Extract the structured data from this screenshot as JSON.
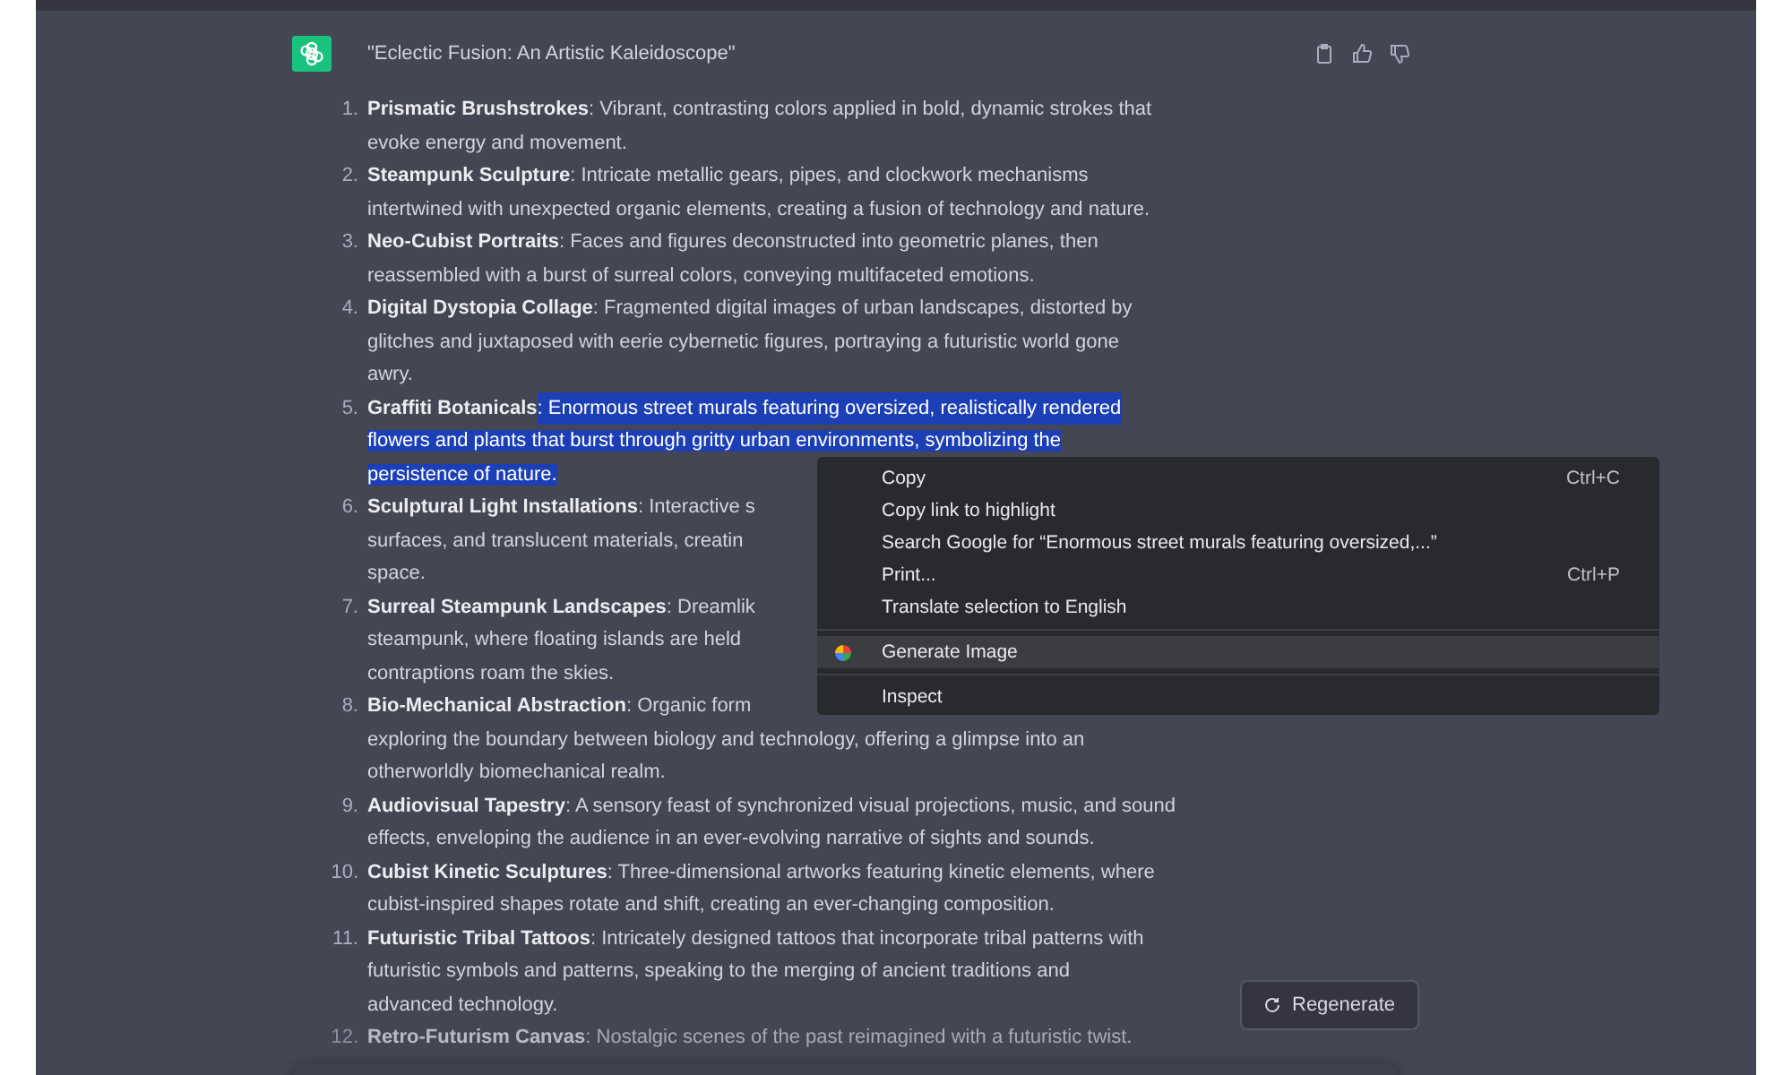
{
  "message": {
    "title": "\"Eclectic Fusion: An Artistic Kaleidoscope\""
  },
  "items": [
    {
      "number": "1.",
      "title": "Prismatic Brushstrokes",
      "highlighted": false,
      "faded": false,
      "lines": [
        ": Vibrant, contrasting colors applied in bold, dynamic strokes that",
        "evoke energy and movement."
      ]
    },
    {
      "number": "2.",
      "title": "Steampunk Sculpture",
      "highlighted": false,
      "faded": false,
      "lines": [
        ": Intricate metallic gears, pipes, and clockwork mechanisms",
        "intertwined with unexpected organic elements, creating a fusion of technology and nature."
      ]
    },
    {
      "number": "3.",
      "title": "Neo-Cubist Portraits",
      "highlighted": false,
      "faded": false,
      "lines": [
        ": Faces and figures deconstructed into geometric planes, then",
        "reassembled with a burst of surreal colors, conveying multifaceted emotions."
      ]
    },
    {
      "number": "4.",
      "title": "Digital Dystopia Collage",
      "highlighted": false,
      "faded": false,
      "lines": [
        ": Fragmented digital images of urban landscapes, distorted by",
        "glitches and juxtaposed with eerie cybernetic figures, portraying a futuristic world gone",
        "awry."
      ]
    },
    {
      "number": "5.",
      "title": "Graffiti Botanicals",
      "highlighted": true,
      "faded": false,
      "lines": [
        ": Enormous street murals featuring oversized, realistically rendered",
        "flowers and plants that burst through gritty urban environments, symbolizing the",
        "persistence of nature."
      ]
    },
    {
      "number": "6.",
      "title": "Sculptural Light Installations",
      "highlighted": false,
      "faded": false,
      "lines": [
        ": Interactive s",
        "surfaces, and translucent materials, creatin",
        "space."
      ]
    },
    {
      "number": "7.",
      "title": "Surreal Steampunk Landscapes",
      "highlighted": false,
      "faded": false,
      "lines": [
        ": Dreamlik",
        "steampunk, where floating islands are held",
        "contraptions roam the skies."
      ]
    },
    {
      "number": "8.",
      "title": "Bio-Mechanical Abstraction",
      "highlighted": false,
      "faded": false,
      "lines": [
        ": Organic form",
        "exploring the boundary between biology and technology, offering a glimpse into an",
        "otherworldly biomechanical realm."
      ]
    },
    {
      "number": "9.",
      "title": "Audiovisual Tapestry",
      "highlighted": false,
      "faded": false,
      "lines": [
        ": A sensory feast of synchronized visual projections, music, and sound",
        "effects, enveloping the audience in an ever-evolving narrative of sights and sounds."
      ]
    },
    {
      "number": "10.",
      "title": "Cubist Kinetic Sculptures",
      "highlighted": false,
      "faded": false,
      "lines": [
        ": Three-dimensional artworks featuring kinetic elements, where",
        "cubist-inspired shapes rotate and shift, creating an ever-changing composition."
      ]
    },
    {
      "number": "11.",
      "title": "Futuristic Tribal Tattoos",
      "highlighted": false,
      "faded": false,
      "lines": [
        ": Intricately designed tattoos that incorporate tribal patterns with",
        "futuristic symbols and patterns, speaking to the merging of ancient traditions and",
        "advanced technology."
      ]
    },
    {
      "number": "12.",
      "title": "Retro-Futurism Canvas",
      "highlighted": false,
      "faded": true,
      "lines": [
        ": Nostalgic scenes of the past reimagined with a futuristic twist."
      ]
    }
  ],
  "context_menu": {
    "items": [
      {
        "kind": "item",
        "label": "Copy",
        "shortcut": "Ctrl+C",
        "selected": false
      },
      {
        "kind": "item",
        "label": "Copy link to highlight",
        "selected": false
      },
      {
        "kind": "item",
        "label": "Search Google for “Enormous street murals featuring oversized,...”",
        "selected": false
      },
      {
        "kind": "item",
        "label": "Print...",
        "shortcut": "Ctrl+P",
        "selected": false
      },
      {
        "kind": "item",
        "label": "Translate selection to English",
        "selected": false
      },
      {
        "kind": "separator"
      },
      {
        "kind": "icon_item",
        "label": "Generate Image",
        "selected": true
      },
      {
        "kind": "separator"
      },
      {
        "kind": "item",
        "label": "Inspect",
        "selected": false
      }
    ]
  },
  "regenerate_button": {
    "label": "Regenerate"
  }
}
